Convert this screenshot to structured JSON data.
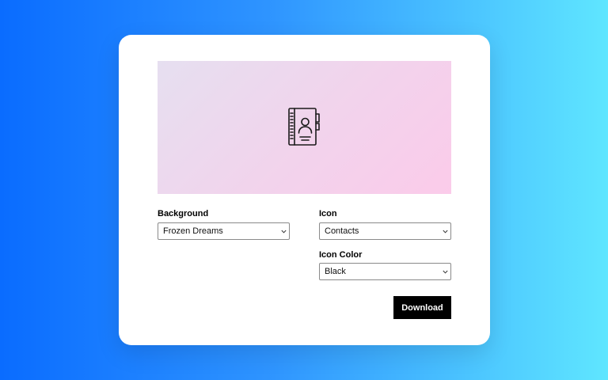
{
  "preview": {
    "icon_name": "contacts-icon",
    "icon_color": "#1a1a1a",
    "gradient": [
      "#e6dff0",
      "#f2d3ec",
      "#fbcbea"
    ]
  },
  "background": {
    "label": "Background",
    "selected": "Frozen Dreams"
  },
  "icon": {
    "label": "Icon",
    "selected": "Contacts"
  },
  "icon_color": {
    "label": "Icon Color",
    "selected": "Black"
  },
  "download": {
    "label": "Download"
  },
  "colors": {
    "page_gradient_start": "#0a6cff",
    "page_gradient_end": "#5fe6ff",
    "button": "#000000"
  }
}
